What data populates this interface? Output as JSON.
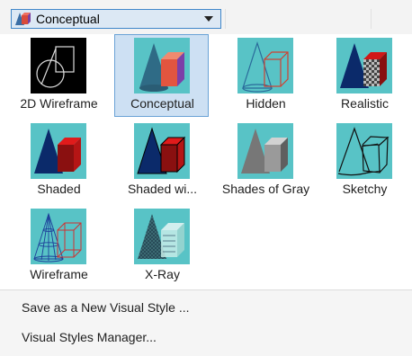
{
  "dropdown": {
    "selected": "Conceptual",
    "icon": "conceptual-style-icon"
  },
  "styles": [
    {
      "label": "2D Wireframe",
      "icon": "2d-wireframe-icon"
    },
    {
      "label": "Conceptual",
      "icon": "conceptual-icon",
      "selected": true
    },
    {
      "label": "Hidden",
      "icon": "hidden-icon"
    },
    {
      "label": "Realistic",
      "icon": "realistic-icon"
    },
    {
      "label": "Shaded",
      "icon": "shaded-icon"
    },
    {
      "label": "Shaded wi...",
      "icon": "shaded-with-edges-icon"
    },
    {
      "label": "Shades of Gray",
      "icon": "shades-of-gray-icon"
    },
    {
      "label": "Sketchy",
      "icon": "sketchy-icon"
    },
    {
      "label": "Wireframe",
      "icon": "wireframe-icon"
    },
    {
      "label": "X-Ray",
      "icon": "x-ray-icon"
    }
  ],
  "menu": {
    "save_new": "Save as a New Visual Style ...",
    "manager": "Visual Styles Manager..."
  },
  "colors": {
    "selection_bg": "#cde0f3",
    "selection_border": "#6aa2d6",
    "thumb_bg": "#58c3c6"
  }
}
